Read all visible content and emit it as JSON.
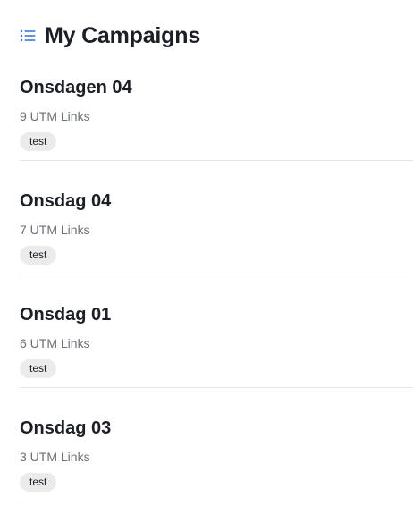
{
  "header": {
    "title": "My Campaigns",
    "icon": "list-icon",
    "accent_color": "#2f6fd1"
  },
  "campaigns": [
    {
      "title": "Onsdagen 04",
      "count": "9 UTM Links",
      "tag": "test"
    },
    {
      "title": "Onsdag 04",
      "count": "7 UTM Links",
      "tag": "test"
    },
    {
      "title": "Onsdag 01",
      "count": "6 UTM Links",
      "tag": "test"
    },
    {
      "title": "Onsdag 03",
      "count": "3 UTM Links",
      "tag": "test"
    }
  ]
}
